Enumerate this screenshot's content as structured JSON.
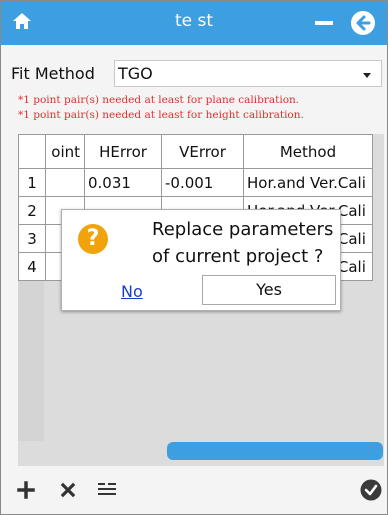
{
  "window": {
    "title": "te st",
    "accent_color": "#3e9fe0",
    "icons": {
      "home": "home-icon",
      "minimize": "minimize-icon",
      "back": "back-arrow-icon"
    }
  },
  "fit_method": {
    "label": "Fit Method",
    "selected": "TGO"
  },
  "warnings": [
    "*1 point pair(s) needed at least for plane calibration.",
    "*1 point pair(s) needed at least for height calibration."
  ],
  "table": {
    "columns": [
      "",
      "oint",
      "HError",
      "VError",
      "Method"
    ],
    "rows": [
      {
        "num": "1",
        "point": "",
        "herror": "0.031",
        "verror": "-0.001",
        "method": "Hor.and Ver.Cali"
      },
      {
        "num": "2",
        "point": "",
        "herror": "",
        "verror": "",
        "method": "Hor.and Ver.Cali"
      },
      {
        "num": "3",
        "point": "",
        "herror": "",
        "verror": "",
        "method": "Hor.and Ver.Cali"
      },
      {
        "num": "4",
        "point": "",
        "herror": "",
        "verror": "",
        "method": "Hor.and Ver.Cali"
      }
    ]
  },
  "dialog": {
    "message": "Replace parameters of current project ?",
    "no_label": "No",
    "yes_label": "Yes",
    "icon": "question-icon",
    "icon_color": "#f0a30a"
  },
  "bottom_bar": {
    "icons": [
      "add-icon",
      "delete-icon",
      "list-icon",
      "confirm-check-icon"
    ]
  }
}
